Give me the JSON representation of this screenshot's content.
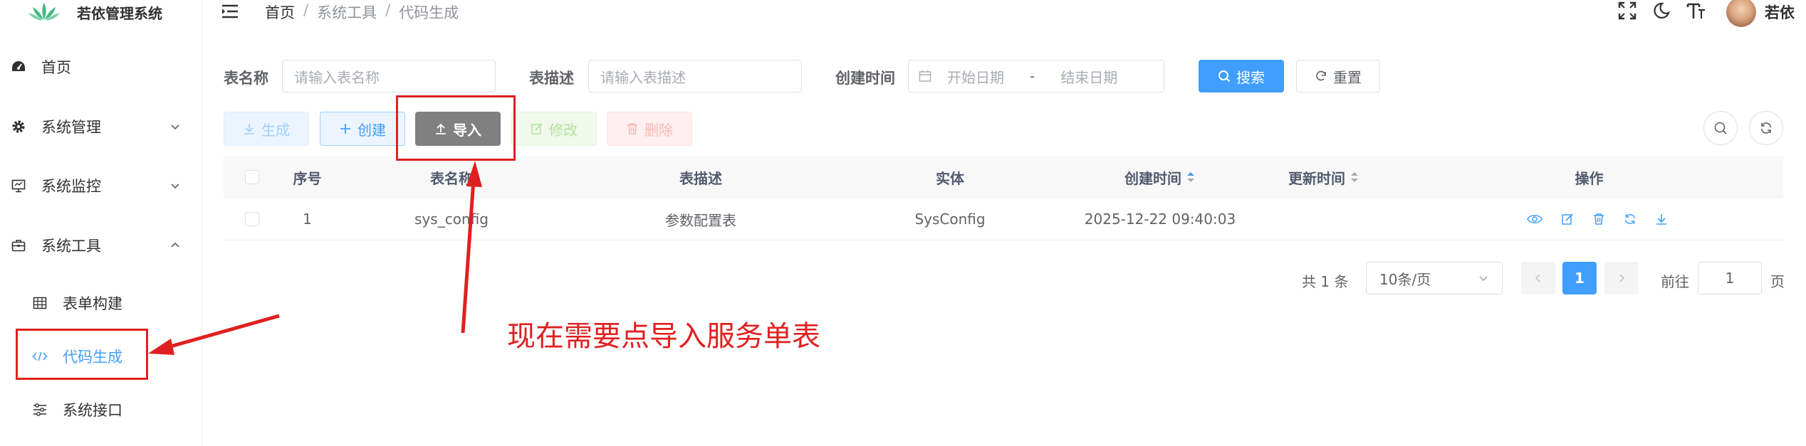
{
  "app": {
    "title": "若依管理系统"
  },
  "sidebar": {
    "items": [
      {
        "label": "首页",
        "icon": "dashboard-icon"
      },
      {
        "label": "系统管理",
        "icon": "gear-icon"
      },
      {
        "label": "系统监控",
        "icon": "monitor-icon"
      },
      {
        "label": "系统工具",
        "icon": "toolbox-icon"
      }
    ],
    "sub_items": [
      {
        "label": "表单构建",
        "icon": "grid-icon"
      },
      {
        "label": "代码生成",
        "icon": "code-icon"
      },
      {
        "label": "系统接口",
        "icon": "sliders-icon"
      }
    ]
  },
  "header": {
    "breadcrumb": [
      "首页",
      "系统工具",
      "代码生成"
    ],
    "sep": "/",
    "user": "若依"
  },
  "search": {
    "table_name_label": "表名称",
    "table_name_placeholder": "请输入表名称",
    "table_desc_label": "表描述",
    "table_desc_placeholder": "请输入表描述",
    "create_time_label": "创建时间",
    "start_placeholder": "开始日期",
    "range_sep": "-",
    "end_placeholder": "结束日期",
    "search_label": "搜索",
    "reset_label": "重置"
  },
  "toolbar": {
    "generate": "生成",
    "create": "创建",
    "import": "导入",
    "edit": "修改",
    "delete": "删除"
  },
  "table": {
    "columns": [
      "序号",
      "表名称",
      "表描述",
      "实体",
      "创建时间",
      "更新时间",
      "操作"
    ],
    "rows": [
      {
        "index": "1",
        "table_name": "sys_config",
        "table_desc": "参数配置表",
        "entity": "SysConfig",
        "create_time": "2025-12-22 09:40:03",
        "update_time": ""
      }
    ]
  },
  "pagination": {
    "total": "共 1 条",
    "page_size": "10条/页",
    "current_page": "1",
    "goto_label": "前往",
    "goto_value": "1",
    "goto_suffix": "页"
  },
  "annotation": {
    "note": "现在需要点导入服务单表"
  },
  "colors": {
    "primary": "#409eff",
    "annotation_red": "#e02020",
    "import_btn": "#808080"
  }
}
